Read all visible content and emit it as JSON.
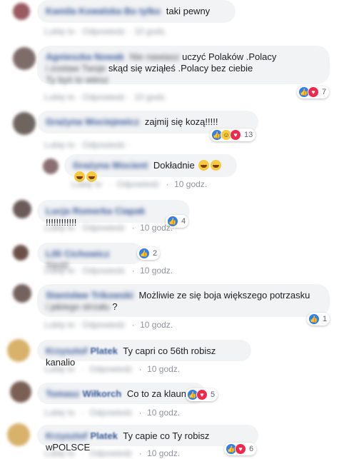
{
  "comments": [
    {
      "id": "c1",
      "text": "taki pewny",
      "time": "10 godz.",
      "reaction_count": ""
    },
    {
      "id": "c2",
      "text_line1": "uczyć Polaków .Polacy",
      "text_line2": "skąd się wziąłeś .Polacy bez ciebie",
      "time": "10 godz.",
      "reaction_count": "7"
    },
    {
      "id": "c3",
      "text": "zajmij się kozą!!!!!",
      "time": "10 godz.",
      "reaction_count": "13"
    },
    {
      "id": "c4",
      "text": "Dokładnie",
      "time": "10 godz.",
      "reaction_count": ""
    },
    {
      "id": "c5",
      "text": "!!!!!!!!!!!!",
      "time": "10 godz.",
      "reaction_count": "4"
    },
    {
      "id": "c6",
      "text": "",
      "time": "10 godz.",
      "reaction_count": "2"
    },
    {
      "id": "c7",
      "text_line1": "Możliwie ze się boja większego potrzasku",
      "text_line2": "?",
      "time": "10 godz.",
      "reaction_count": "1"
    },
    {
      "id": "c8",
      "name": "Platek",
      "text": "Ty capri co 56th robisz kanalio",
      "time": "10 godz.",
      "reaction_count": ""
    },
    {
      "id": "c9",
      "name": "Wiłkorch",
      "text": "Co to za klaun?",
      "time": "10 godz.",
      "reaction_count": "5"
    },
    {
      "id": "c10",
      "name": "Platek",
      "text": "Ty capie co Ty robisz wPOLSCE",
      "time": "10 godz.",
      "reaction_count": "6"
    }
  ],
  "labels": {
    "reply": "Odpowiedz",
    "dot": "·"
  },
  "colors": {
    "name": "#385898",
    "bubble": "#f2f3f5",
    "meta": "#90949c",
    "like": "#2f7ff0",
    "love": "#f0284a",
    "haha": "#f7c93f"
  }
}
